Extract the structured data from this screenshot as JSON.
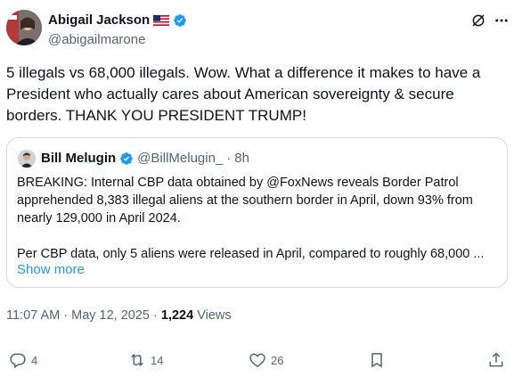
{
  "author": {
    "name": "Abigail Jackson",
    "handle": "@abigailmarone"
  },
  "tweet": {
    "text": "5 illegals vs 68,000 illegals. Wow. What a difference it makes to have a President who actually cares about American sovereignty & secure borders. THANK YOU PRESIDENT TRUMP!"
  },
  "quote": {
    "name": "Bill Melugin",
    "handle": "@BillMelugin_",
    "separator": "·",
    "time": "8h",
    "text": "BREAKING: Internal CBP data obtained by @FoxNews reveals Border Patrol apprehended 8,383 illegal aliens at the southern border in April, down 93% from nearly 129,000 in April 2024.\n\nPer CBP data, only 5 aliens were released in April, compared to roughly 68,000 ...",
    "show_more": "Show more"
  },
  "meta": {
    "time": "11:07 AM",
    "sep1": "·",
    "date": "May 12, 2025",
    "sep2": "·",
    "views_count": "1,224",
    "views_label": "Views"
  },
  "actions": {
    "replies": "4",
    "reposts": "14",
    "likes": "26"
  },
  "colors": {
    "verified": "#1d9bf0",
    "link": "#1d9bf0",
    "secondary": "#536471",
    "border": "#cfd9de"
  },
  "icons": [
    "flag-us-icon",
    "verified-badge-icon",
    "grok-icon",
    "more-icon",
    "reply-icon",
    "repost-icon",
    "like-icon",
    "bookmark-icon",
    "share-icon"
  ]
}
